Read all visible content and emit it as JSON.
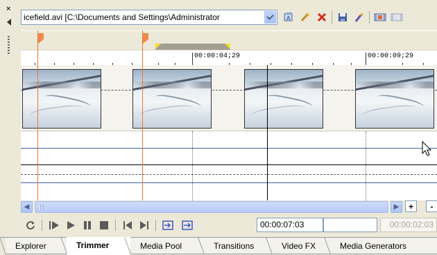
{
  "window": {
    "panel_name": "Trimmer"
  },
  "toolbar": {
    "file_combo_value": "icefield.avi    [C:\\Documents and Settings\\Administrator",
    "buttons": [
      {
        "name": "open-media-icon"
      },
      {
        "name": "wand-icon"
      },
      {
        "name": "close-icon"
      },
      {
        "name": "save-icon"
      },
      {
        "name": "markers-icon"
      },
      {
        "name": "add-to-timeline-icon"
      },
      {
        "name": "extra-icon"
      }
    ]
  },
  "ruler": {
    "labels": [
      "00:00:04;29",
      "00:00:09;29"
    ]
  },
  "transport": {
    "current_time": "00:00:07:03",
    "selection_length": "",
    "duration": "00:00:02:03"
  },
  "scrollbar": {
    "zoom_in_label": "+",
    "zoom_out_label": "-"
  },
  "tabs": [
    {
      "label": "Explorer",
      "active": false
    },
    {
      "label": "Trimmer",
      "active": true
    },
    {
      "label": "Media Pool",
      "active": false
    },
    {
      "label": "Transitions",
      "active": false
    },
    {
      "label": "Video FX",
      "active": false
    },
    {
      "label": "Media Generators",
      "active": false
    }
  ],
  "colors": {
    "marker_orange": "#e3773d",
    "loop_region": "#a39f90",
    "loop_handles": "#f4e12b",
    "audio_lines_blue": "#3f62a5"
  }
}
